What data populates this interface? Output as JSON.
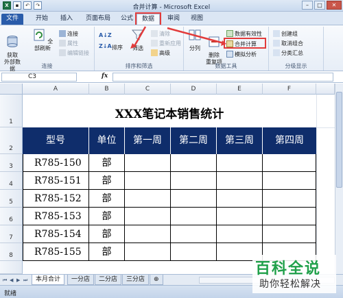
{
  "window": {
    "title": "合并计算 - Microsoft Excel",
    "controls": [
      "–",
      "□",
      "✕"
    ]
  },
  "ribbon_tabs": [
    {
      "label": "文件"
    },
    {
      "label": "开始"
    },
    {
      "label": "插入"
    },
    {
      "label": "页面布局"
    },
    {
      "label": "公式"
    },
    {
      "label": "数据"
    },
    {
      "label": "审阅"
    },
    {
      "label": "视图"
    }
  ],
  "ribbon": {
    "connections_group": {
      "label": "连接",
      "get_external_data": "获取\n外部数据",
      "refresh_all": "全部刷新",
      "connections": "连接",
      "properties": "属性",
      "edit_links": "编辑链接"
    },
    "sort_filter_group": {
      "label": "排序和筛选",
      "sort": "排序",
      "filter": "筛选",
      "clear": "清除",
      "reapply": "重新应用",
      "advanced": "高级"
    },
    "data_tools_group": {
      "label": "数据工具",
      "text_to_columns": "分列",
      "remove_duplicates": "删除\n重复项",
      "data_validation": "数据有效性",
      "consolidate": "合并计算",
      "what_if": "模拟分析"
    },
    "outline_group": {
      "label": "分级显示",
      "group": "创建组",
      "ungroup": "取消组合",
      "subtotal": "分类汇总"
    }
  },
  "formula_bar": {
    "name_box": "C3",
    "fx": "fx",
    "value": ""
  },
  "columns": [
    "A",
    "B",
    "C",
    "D",
    "E",
    "F"
  ],
  "rows": [
    "1",
    "2",
    "3",
    "4",
    "5",
    "6",
    "7",
    "8"
  ],
  "sheet": {
    "title": "XXX笔记本销售统计",
    "headers": [
      "型号",
      "单位",
      "第一周",
      "第二周",
      "第三周",
      "第四周"
    ],
    "data": [
      [
        "R785-150",
        "部"
      ],
      [
        "R785-151",
        "部"
      ],
      [
        "R785-152",
        "部"
      ],
      [
        "R785-153",
        "部"
      ],
      [
        "R785-154",
        "部"
      ],
      [
        "R785-155",
        "部"
      ]
    ]
  },
  "sheet_tabs": [
    "本月合计",
    "一分店",
    "二分店",
    "三分店"
  ],
  "status": {
    "ready": "就绪"
  },
  "watermark": {
    "line1": "百科全说",
    "line2": "助你轻松解决"
  },
  "colors": {
    "header_fill": "#0f2d6b",
    "highlight_red": "#e23b3b",
    "file_tab": "#2a5caa"
  }
}
